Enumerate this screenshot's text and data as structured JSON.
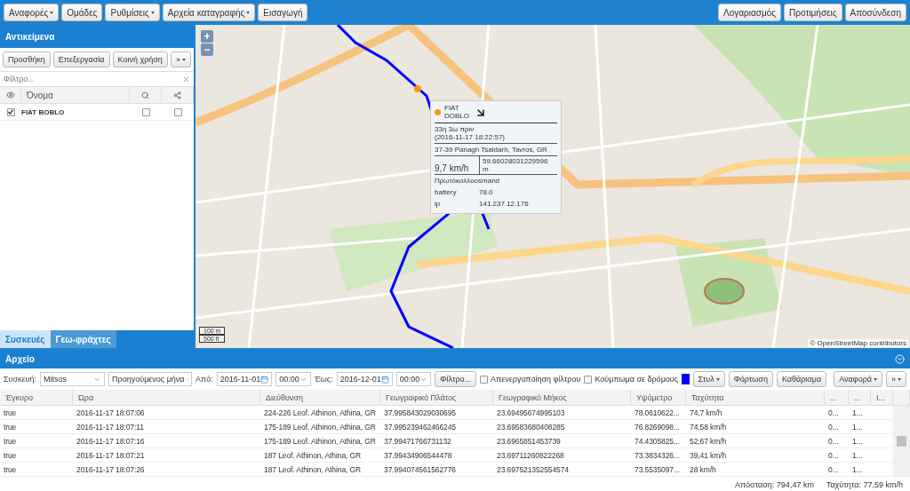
{
  "toolbar": {
    "left": [
      {
        "label": "Αναφορές",
        "dropdown": true
      },
      {
        "label": "Ομάδες",
        "dropdown": false
      },
      {
        "label": "Ρυθμίσεις",
        "dropdown": true
      },
      {
        "label": "Αρχεία καταγραφής",
        "dropdown": true
      },
      {
        "label": "Εισαγωγή",
        "dropdown": false
      }
    ],
    "right": [
      {
        "label": "Λογαριασμός",
        "dropdown": false
      },
      {
        "label": "Προτιμήσεις",
        "dropdown": false
      },
      {
        "label": "Αποσύνδεση",
        "dropdown": false
      }
    ]
  },
  "objects_panel": {
    "title": "Αντικείμενα",
    "buttons": [
      {
        "label": "Προσθήκη",
        "dropdown": false
      },
      {
        "label": "Επεξεργασία",
        "dropdown": false
      },
      {
        "label": "Κοινή χρήση",
        "dropdown": false
      },
      {
        "label": "»",
        "dropdown": true
      }
    ],
    "filter": {
      "placeholder": "Φίλτρο..."
    },
    "name_column": "Όνομα",
    "rows": [
      {
        "name": "FIAT BOBLO",
        "visible": true,
        "follow": false,
        "trail": false
      }
    ],
    "tabs": [
      {
        "label": "Συσκευές",
        "selected": true
      },
      {
        "label": "Γεω-φράχτες",
        "selected": false
      }
    ]
  },
  "map": {
    "zoom": [
      "+",
      "−"
    ],
    "scale": [
      "100 m",
      "500 ft"
    ],
    "attribution": "© OpenStreetMap contributors",
    "popup": {
      "name": "FIAT DOBLO",
      "age": "33η 3ω πριν",
      "timestamp": "(2016-11-17 18:22:57)",
      "address": "37-39 Panagh Tsaldarh, Tavros, GR",
      "speed": "9,7 km/h",
      "distance": "59.66028031229596 m",
      "protocol": "Πρωτόκολλοosmand",
      "attributes": [
        {
          "key": "battery",
          "value": "78.0"
        },
        {
          "key": "ip",
          "value": "141.237.12.176"
        }
      ]
    }
  },
  "archive": {
    "title": "Αρχείο",
    "device_label": "Συσκευή:",
    "device": "Mitsos",
    "period": "Προηγούμενος μήνα",
    "from_label": "Από:",
    "from_date": "2016-11-01",
    "from_time": "00:00",
    "to_label": "Έως:",
    "to_date": "2016-12-01",
    "to_time": "00:00",
    "filter_button": "Φίλτρο...",
    "options": [
      {
        "label": "Απενεργοποίηση φίλτρου",
        "checked": false
      },
      {
        "label": "Κούμπωμα σε δρόμους",
        "checked": false
      }
    ],
    "buttons": [
      {
        "label": "Στυλ",
        "dropdown": true
      },
      {
        "label": "Φόρτωση",
        "dropdown": false
      },
      {
        "label": "Καθάρισμα",
        "dropdown": false
      }
    ],
    "right_buttons": [
      {
        "label": "Αναφορά",
        "dropdown": true
      },
      {
        "label": "»",
        "dropdown": true
      }
    ],
    "columns": [
      "Έγκυρο",
      "Ώρα",
      "Διεύθυνση",
      "Γεωγραφικό Πλάτος",
      "Γεωγραφικό Μήκος",
      "Υψόμετρο",
      "Ταχύτητα",
      "...",
      "...",
      "Ι..."
    ],
    "rows": [
      [
        "true",
        "2016-11-17 18:07:06",
        "224-226 Leof. Athinon, Athina, GR",
        "37.995843029030695",
        "23.69495674995103",
        "78.0610622...",
        "74,7 km/h",
        "0...",
        "1...",
        ""
      ],
      [
        "true",
        "2016-11-17 18:07:11",
        "175-189 Leof. Athinon, Athina, GR",
        "37.995239462466245",
        "23.69583680408285",
        "76.8269098...",
        "74,58 km/h",
        "0...",
        "1...",
        ""
      ],
      [
        "true",
        "2016-11-17 18:07:16",
        "175-189 Leof. Athinon, Athina, GR",
        "37.99471766731132",
        "23.6965851453739",
        "74.4305825...",
        "52,67 km/h",
        "0...",
        "1...",
        ""
      ],
      [
        "true",
        "2016-11-17 18:07:21",
        "187 Leof. Athinon, Athina, GR",
        "37.99434906544478",
        "23.69711260822268",
        "73.3834326...",
        "39,41 km/h",
        "0...",
        "1...",
        ""
      ],
      [
        "true",
        "2016-11-17 18:07:26",
        "187 Leof. Athinon, Athina, GR",
        "37.994074561562776",
        "23.697521352554574",
        "73.5535097...",
        "28 km/h",
        "0...",
        "1...",
        ""
      ]
    ],
    "summary": [
      {
        "label": "Απόσταση:",
        "value": "794,47 km"
      },
      {
        "label": "Ταχύτητα:",
        "value": "77,59 km/h"
      }
    ]
  }
}
